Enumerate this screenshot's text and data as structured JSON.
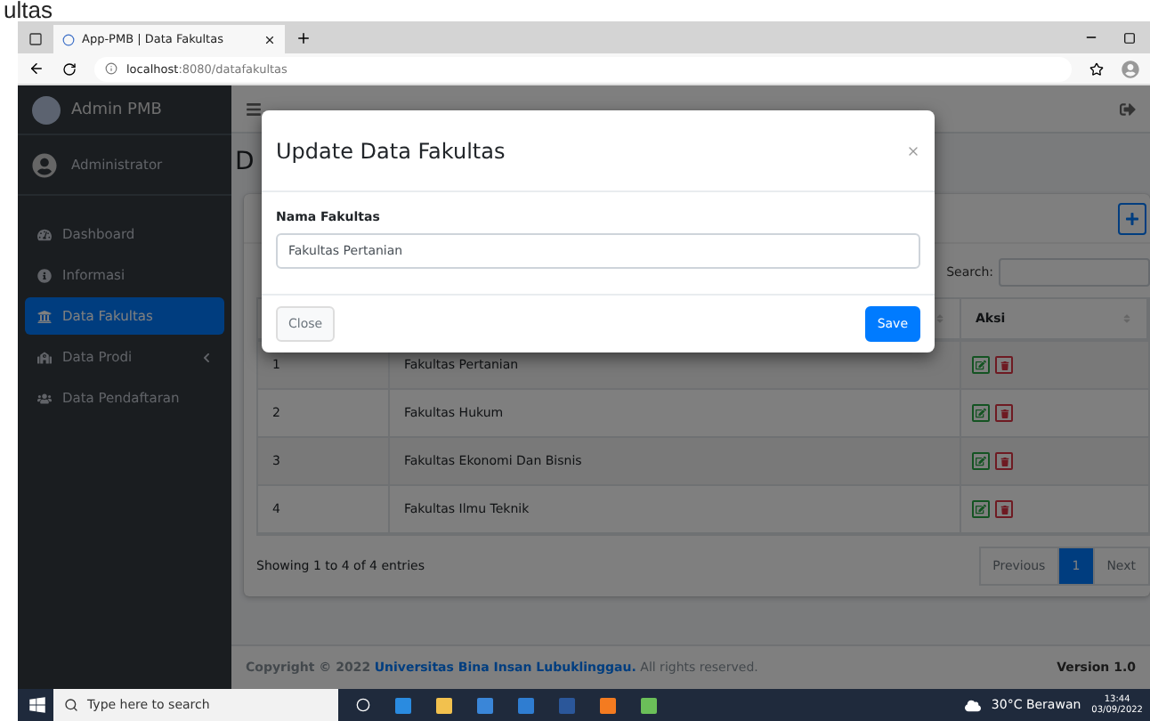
{
  "top_fragment": "ultas",
  "browser": {
    "tab_title": "App-PMB | Data Fakultas",
    "url_host": "localhost",
    "url_path": ":8080/datafakultas"
  },
  "sidebar": {
    "brand": "Admin PMB",
    "user": "Administrator",
    "items": [
      {
        "label": "Dashboard",
        "kind": "dashboard",
        "selected": false
      },
      {
        "label": "Informasi",
        "kind": "info",
        "selected": false
      },
      {
        "label": "Data Fakultas",
        "kind": "faculty",
        "selected": true
      },
      {
        "label": "Data Prodi",
        "kind": "prodi",
        "selected": false,
        "expanded": false
      },
      {
        "label": "Data Pendaftaran",
        "kind": "users",
        "selected": false
      }
    ]
  },
  "page": {
    "heading": "D",
    "search_label": "Search:",
    "action_column": "Aksi",
    "rows": [
      {
        "no": "1",
        "name": "Fakultas Pertanian"
      },
      {
        "no": "2",
        "name": "Fakultas Hukum"
      },
      {
        "no": "3",
        "name": "Fakultas Ekonomi Dan Bisnis"
      },
      {
        "no": "4",
        "name": "Fakultas Ilmu Teknik"
      }
    ],
    "info": "Showing 1 to 4 of 4 entries",
    "pagination": [
      {
        "label": "Previous",
        "selected": false
      },
      {
        "label": "1",
        "selected": true
      },
      {
        "label": "Next",
        "selected": false
      }
    ]
  },
  "footer": {
    "prefix": "Copyright © 2022",
    "link": "Universitas Bina Insan Lubuklinggau.",
    "suffix": "All rights reserved.",
    "version": "Version 1.0"
  },
  "modal": {
    "title": "Update Data Fakultas",
    "field_label": "Nama Fakultas",
    "field_value": "Fakultas Pertanian",
    "buttons": [
      {
        "label": "Close",
        "kind": "secondary"
      },
      {
        "label": "Save",
        "kind": "primary"
      }
    ]
  },
  "taskbar": {
    "search_placeholder": "Type here to search",
    "weather": "30°C  Berawan",
    "time": "13:44",
    "date": "03/09/2022"
  }
}
